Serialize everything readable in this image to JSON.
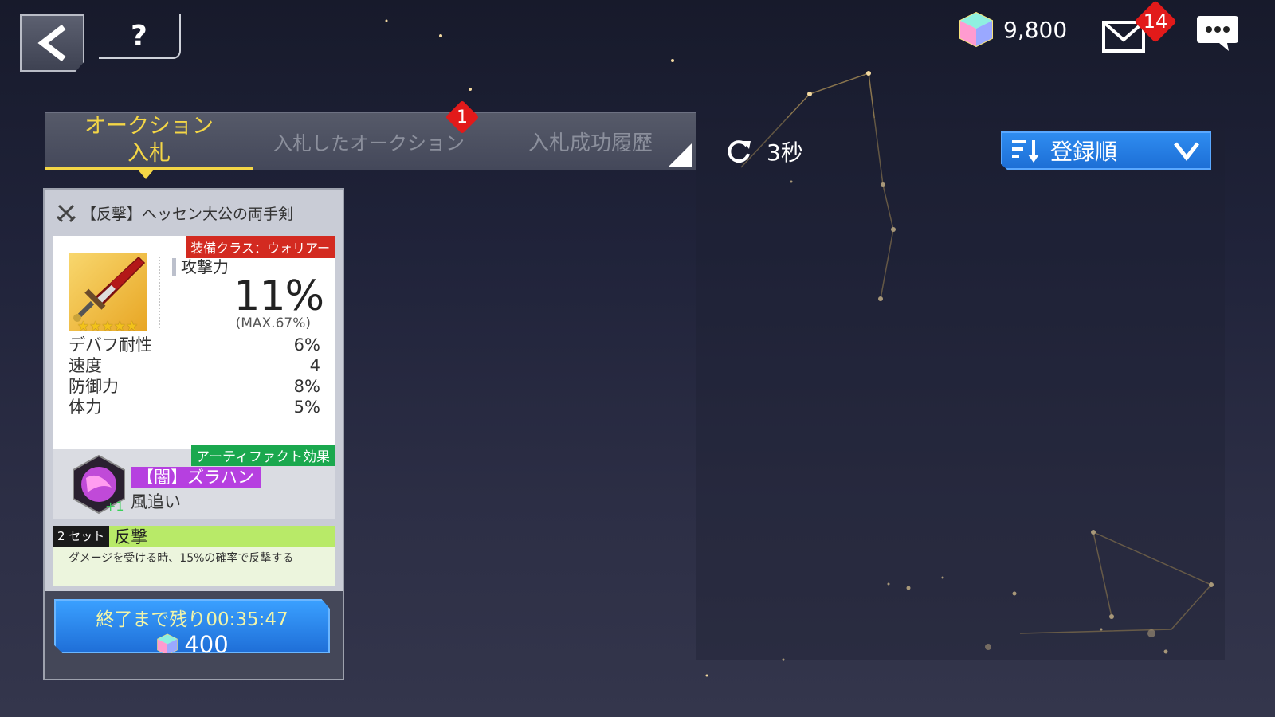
{
  "header": {
    "back_icon": "back-arrow-icon",
    "help_label": "?",
    "crystal_amount": "9,800",
    "mail_badge": "14",
    "chat_icon": "chat-icon"
  },
  "tabs": {
    "auction_line1": "オークション",
    "auction_line2": "入札",
    "bid_auctions": "入札したオークション",
    "bid_badge": "1",
    "bid_history": "入札成功履歴"
  },
  "toolbar": {
    "refresh_label": "3秒",
    "sort_label": "登録順"
  },
  "card": {
    "item_name": "【反撃】ヘッセン大公の両手剣",
    "class_tag": "装備クラス：ウォリアー",
    "main_stat_label": "攻撃力",
    "main_stat_value": "11%",
    "main_stat_max": "(MAX.67%)",
    "sub_stats": [
      {
        "label": "デバフ耐性",
        "value": "6%"
      },
      {
        "label": "速度",
        "value": "4"
      },
      {
        "label": "防御力",
        "value": "8%"
      },
      {
        "label": "体力",
        "value": "5%"
      }
    ],
    "stars": 5,
    "artifact_tag": "アーティファクト効果",
    "artifact_name": "【闇】ズラハン",
    "artifact_skill": "風追い",
    "artifact_plus": "+1",
    "set_count": "2 セット",
    "set_name": "反撃",
    "set_desc": "ダメージを受ける時、15%の確率で反撃する",
    "time_left": "終了まで残り00:35:47",
    "price": "400"
  },
  "colors": {
    "accent_yellow": "#f4d646",
    "accent_blue": "#1f6fd8",
    "badge_red": "#e21a1a",
    "class_red": "#d32a20",
    "artifact_green": "#1aa84e",
    "artifact_purple": "#b640e0",
    "set_green": "#b8ea68"
  }
}
